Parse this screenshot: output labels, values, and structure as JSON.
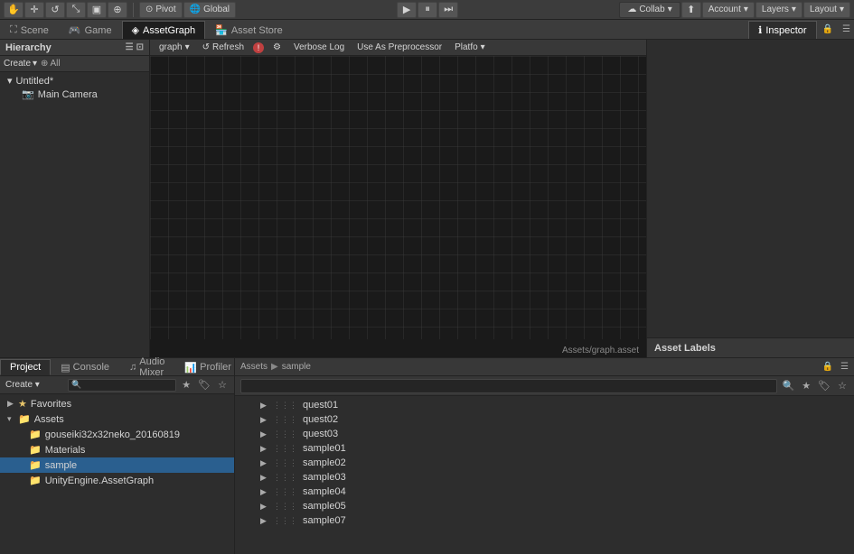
{
  "topToolbar": {
    "pivotLabel": "Pivot",
    "globalLabel": "Global",
    "playBtn": "▶",
    "pauseBtn": "⏸",
    "stepBtn": "⏭",
    "collabLabel": "Collab",
    "accountLabel": "Account",
    "layersLabel": "Layers",
    "layoutLabel": "Layout"
  },
  "tabs": {
    "scene": "Scene",
    "game": "Game",
    "assetGraph": "AssetGraph",
    "assetStore": "Asset Store",
    "inspector": "Inspector"
  },
  "assetGraphToolbar": {
    "graph": "graph",
    "refresh": "Refresh",
    "verboseLog": "Verbose Log",
    "useAsProcessor": "Use As Preprocessor",
    "platform": "Platfo"
  },
  "hierarchy": {
    "title": "Hierarchy",
    "create": "Create",
    "searchAll": "⊕All",
    "untitled": "Untitled*",
    "mainCamera": "Main Camera"
  },
  "inspector": {
    "title": "Inspector",
    "assetLabels": "Asset Labels"
  },
  "project": {
    "title": "Project",
    "console": "Console",
    "audioMixer": "Audio Mixer",
    "profiler": "Profiler",
    "create": "Create ▾",
    "favorites": "Favorites",
    "assets": "Assets",
    "folders": [
      {
        "name": "gouseiki32x32neko_20160819",
        "indent": 1,
        "hasArrow": false
      },
      {
        "name": "Materials",
        "indent": 1,
        "hasArrow": false
      },
      {
        "name": "sample",
        "indent": 1,
        "hasArrow": false,
        "selected": true
      },
      {
        "name": "UnityEngine.AssetGraph",
        "indent": 1,
        "hasArrow": false
      }
    ]
  },
  "fileList": {
    "breadcrumb1": "Assets",
    "breadcrumb2": "sample",
    "items": [
      {
        "name": "quest01"
      },
      {
        "name": "quest02"
      },
      {
        "name": "quest03"
      },
      {
        "name": "sample01"
      },
      {
        "name": "sample02"
      },
      {
        "name": "sample03"
      },
      {
        "name": "sample04"
      },
      {
        "name": "sample05"
      },
      {
        "name": "sample07"
      }
    ]
  },
  "viewport": {
    "statusText": "Assets/graph.asset"
  }
}
